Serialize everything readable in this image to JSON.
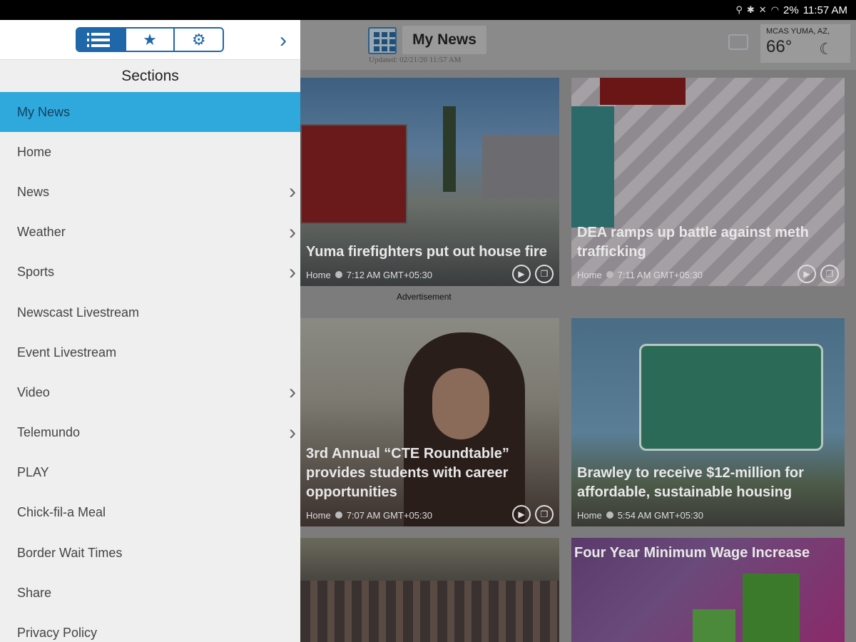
{
  "status_bar": {
    "icons": [
      "location-icon",
      "bluetooth-icon",
      "mute-icon",
      "wifi-icon"
    ],
    "battery": "2%",
    "time": "11:57 AM"
  },
  "header": {
    "title": "My News",
    "updated": "Updated: 02/21/20 11:57 AM",
    "weather": {
      "location": "MCAS YUMA, AZ,",
      "temp": "66°"
    }
  },
  "drawer": {
    "tabs": [
      "list-icon",
      "star-icon",
      "gear-icon"
    ],
    "sections_title": "Sections",
    "items": [
      {
        "label": "My News",
        "active": true,
        "chevron": false
      },
      {
        "label": "Home",
        "chevron": false
      },
      {
        "label": "News",
        "chevron": true
      },
      {
        "label": "Weather",
        "chevron": true
      },
      {
        "label": "Sports",
        "chevron": true
      },
      {
        "label": "Newscast Livestream",
        "chevron": false
      },
      {
        "label": "Event Livestream",
        "chevron": false
      },
      {
        "label": "Video",
        "chevron": true
      },
      {
        "label": "Telemundo",
        "chevron": true
      },
      {
        "label": "PLAY",
        "chevron": false
      },
      {
        "label": "Chick-fil-a Meal",
        "chevron": false
      },
      {
        "label": "Border Wait Times",
        "chevron": false
      },
      {
        "label": "Share",
        "chevron": false
      },
      {
        "label": "Privacy Policy",
        "chevron": false
      }
    ]
  },
  "advertisement": "Advertisement",
  "cards": [
    {
      "headline": "Yuma firefighters put out house fire",
      "section": "Home",
      "time": "7:12 AM GMT+05:30"
    },
    {
      "headline": "DEA ramps up battle against meth trafficking",
      "section": "Home",
      "time": "7:11 AM GMT+05:30"
    },
    {
      "headline": "3rd Annual “CTE Roundtable” provides students with career opportunities",
      "section": "Home",
      "time": "7:07 AM GMT+05:30"
    },
    {
      "headline": "Brawley to receive $12-million for affordable, sustainable housing",
      "section": "Home",
      "time": "5:54 AM GMT+05:30"
    },
    {
      "headline": ""
    },
    {
      "headline": "Four Year Minimum Wage Increase"
    }
  ],
  "colors": {
    "accent": "#1f67a8",
    "active_item": "#2fa8dc"
  }
}
